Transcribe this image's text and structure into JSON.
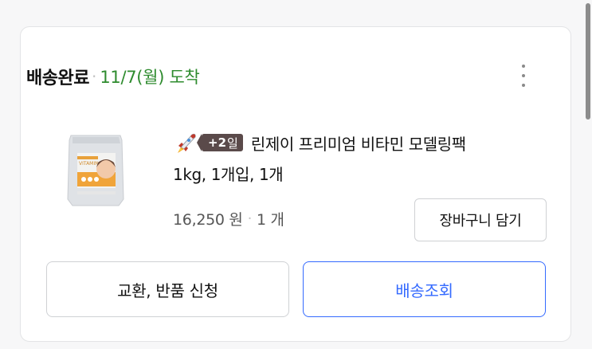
{
  "order": {
    "status": "배송완료",
    "separator": "·",
    "arrival": "11/7(월) 도착"
  },
  "icons": {
    "more": "more-vertical-icon",
    "rocket": "rocket-delivery-icon"
  },
  "product": {
    "badge_count": "+2",
    "badge_unit": "일",
    "name_line1": "린제이 프리미엄 비타민 모델링팩",
    "name_line2": "1kg, 1개입, 1개",
    "price": "16,250 원",
    "separator": "·",
    "quantity": "1 개",
    "cart_button": "장바구니 담기",
    "image_label": "VITAMIN"
  },
  "actions": {
    "exchange_return": "교환, 반품 신청",
    "track_delivery": "배송조회"
  },
  "colors": {
    "status_green": "#2e8b2e",
    "accent_blue": "#346aff",
    "badge_bg": "#5a4a4a",
    "border": "#cfd1d4"
  }
}
